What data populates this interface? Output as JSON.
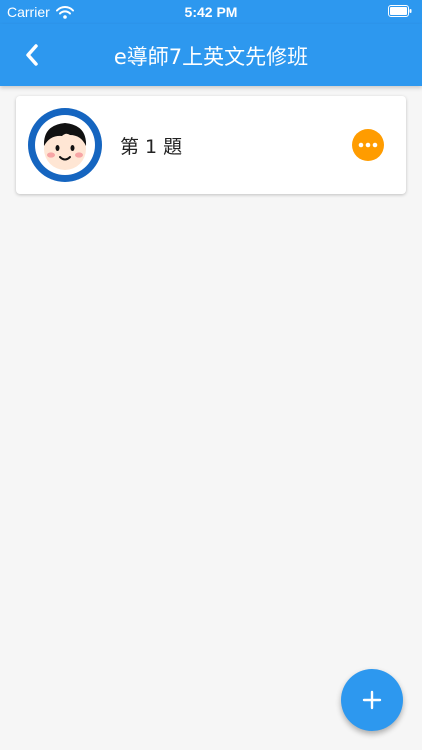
{
  "status_bar": {
    "carrier": "Carrier",
    "time": "5:42 PM"
  },
  "nav": {
    "title": "e導師7上英文先修班",
    "back_icon": "chevron-left-icon"
  },
  "list": {
    "items": [
      {
        "title": "第 1 題",
        "avatar_icon": "child-face-icon",
        "action_icon": "more-icon"
      }
    ]
  },
  "fab": {
    "icon": "plus-icon"
  },
  "colors": {
    "primary": "#2d98ef",
    "accent": "#ff9c00",
    "background": "#f6f6f6",
    "avatar_ring": "#1565c0"
  }
}
